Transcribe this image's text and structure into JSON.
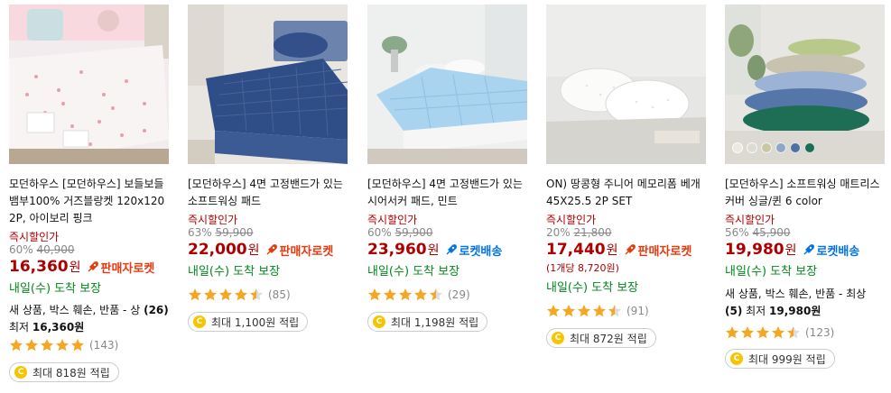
{
  "products": [
    {
      "title": "모던하우스 [모던하우스] 보들보들 뱀부100% 거즈블랑켓 120x120 2P, 아이보리 핑크",
      "promo": "즉시할인가",
      "discount": "60%",
      "original_price": "40,900",
      "price": "16,360",
      "won": "원",
      "badge": "판매자로켓",
      "badge_type": "seller",
      "unit_price": "",
      "arrival": "내일(수) 도착 보장",
      "used_prefix": "새 상품, 박스 훼손, 반품 - 상",
      "used_count": "(26)",
      "used_mid": " 최저 ",
      "used_price": "16,360원",
      "rating": 5.0,
      "review_count": "(143)",
      "reward": "최대 818원 적립",
      "image_icon": "gauze-blanket-photo"
    },
    {
      "title": "[모던하우스] 4면 고정밴드가 있는 소프트워싱 패드",
      "promo": "즉시할인가",
      "discount": "63%",
      "original_price": "59,900",
      "price": "22,000",
      "won": "원",
      "badge": "판매자로켓",
      "badge_type": "seller",
      "unit_price": "",
      "arrival": "내일(수) 도착 보장",
      "rating": 4.5,
      "review_count": "(85)",
      "reward": "최대 1,100원 적립",
      "image_icon": "navy-mattress-pad-photo"
    },
    {
      "title": "[모던하우스] 4면 고정밴드가 있는 시어서커 패드, 민트",
      "promo": "즉시할인가",
      "discount": "60%",
      "original_price": "59,900",
      "price": "23,960",
      "won": "원",
      "badge": "로켓배송",
      "badge_type": "rocket",
      "unit_price": "",
      "arrival": "내일(수) 도착 보장",
      "rating": 4.5,
      "review_count": "(29)",
      "reward": "최대 1,198원 적립",
      "image_icon": "mint-mattress-pad-photo"
    },
    {
      "title": "ON) 땅콩형 주니어 메모리폼 베개 45X25.5 2P SET",
      "promo": "즉시할인가",
      "discount": "20%",
      "original_price": "21,800",
      "price": "17,440",
      "won": "원",
      "badge": "판매자로켓",
      "badge_type": "seller",
      "unit_price": "(1개당 8,720원)",
      "arrival": "내일(수) 도착 보장",
      "rating": 4.5,
      "review_count": "(91)",
      "reward": "최대 872원 적립",
      "image_icon": "memory-foam-pillow-photo"
    },
    {
      "title": "[모던하우스] 소프트워싱 매트리스커버 싱글/퀸 6 color",
      "promo": "즉시할인가",
      "discount": "56%",
      "original_price": "45,900",
      "price": "19,980",
      "won": "원",
      "badge": "로켓배송",
      "badge_type": "rocket",
      "unit_price": "",
      "arrival": "내일(수) 도착 보장",
      "used_prefix": "새 상품, 박스 훼손, 반품 - 최상",
      "used_count": "(5)",
      "used_mid": " 최저 ",
      "used_price": "19,980원",
      "rating": 4.5,
      "review_count": "(123)",
      "reward": "최대 999원 적립",
      "image_icon": "mattress-cover-stack-photo",
      "swatch_colors": [
        "#ece9e1",
        "#dcdcd0",
        "#c9c7a5",
        "#8fa6c4",
        "#4f6f9c",
        "#1f6b55"
      ]
    }
  ],
  "colors": {
    "price": "#ae0000",
    "arrival": "#00891a",
    "seller_badge": "#e8380d",
    "rocket_badge": "#0073e9",
    "star": "#f5a623",
    "coin": "#f7c500"
  }
}
